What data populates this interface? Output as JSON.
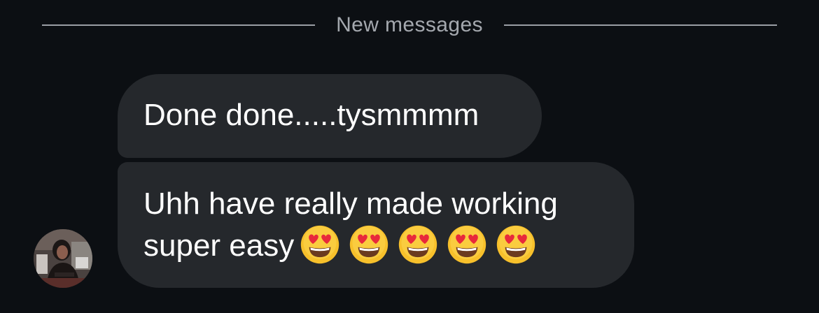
{
  "divider": {
    "label": "New messages"
  },
  "messages": [
    {
      "text": "Done done.....tysmmmm"
    },
    {
      "line1": "Uhh have really made working",
      "line2": "super easy",
      "emojis": [
        "heart-eyes-emoji",
        "heart-eyes-emoji",
        "heart-eyes-emoji",
        "heart-eyes-emoji",
        "heart-eyes-emoji"
      ]
    }
  ],
  "sender": {
    "avatar_icon": "profile-photo"
  },
  "colors": {
    "background": "#0c0f13",
    "bubble": "#25282c",
    "text": "#ffffff",
    "divider_text": "#a4a8ae",
    "divider_line": "#9a9ea5"
  }
}
